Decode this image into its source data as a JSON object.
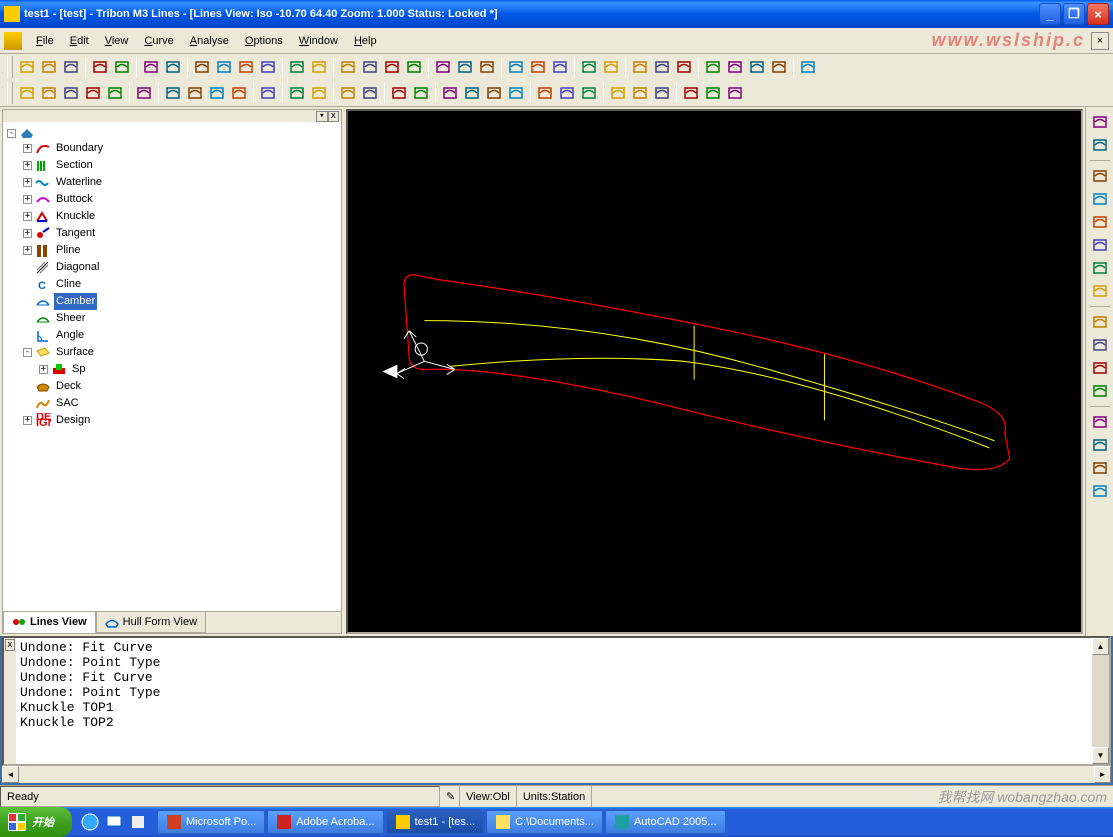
{
  "title": "test1 - [test] - Tribon M3 Lines - [Lines View: Iso -10.70 64.40   Zoom: 1.000   Status: Locked *]",
  "watermark_top": "www.wslship.c",
  "menus": [
    "File",
    "Edit",
    "View",
    "Curve",
    "Analyse",
    "Options",
    "Window",
    "Help"
  ],
  "tree": {
    "root_icon": "ship-icon",
    "items": [
      {
        "level": 1,
        "box": "+",
        "icon": "curve-red",
        "label": "Boundary"
      },
      {
        "level": 1,
        "box": "+",
        "icon": "curve-green",
        "label": "Section"
      },
      {
        "level": 1,
        "box": "+",
        "icon": "wave-blue",
        "label": "Waterline"
      },
      {
        "level": 1,
        "box": "+",
        "icon": "curve-pink",
        "label": "Buttock"
      },
      {
        "level": 1,
        "box": "+",
        "icon": "knuckle",
        "label": "Knuckle"
      },
      {
        "level": 1,
        "box": "+",
        "icon": "tangent",
        "label": "Tangent"
      },
      {
        "level": 1,
        "box": "+",
        "icon": "pline",
        "label": "Pline"
      },
      {
        "level": 1,
        "box": "",
        "icon": "diagonal",
        "label": "Diagonal"
      },
      {
        "level": 1,
        "box": "",
        "icon": "cline",
        "label": "Cline"
      },
      {
        "level": 1,
        "box": "",
        "icon": "camber",
        "label": "Camber",
        "selected": true
      },
      {
        "level": 1,
        "box": "",
        "icon": "sheer",
        "label": "Sheer"
      },
      {
        "level": 1,
        "box": "",
        "icon": "angle",
        "label": "Angle"
      },
      {
        "level": 1,
        "box": "-",
        "icon": "surface",
        "label": "Surface"
      },
      {
        "level": 2,
        "box": "+",
        "icon": "sp",
        "label": "Sp"
      },
      {
        "level": 1,
        "box": "",
        "icon": "deck",
        "label": "Deck"
      },
      {
        "level": 1,
        "box": "",
        "icon": "sac",
        "label": "SAC"
      },
      {
        "level": 1,
        "box": "+",
        "icon": "design",
        "label": "Design"
      }
    ]
  },
  "tree_tabs": {
    "active": "Lines View",
    "other": "Hull Form View"
  },
  "console_lines": [
    "Undone: Fit Curve",
    "Undone: Point Type",
    "Undone: Fit Curve",
    "Undone: Point Type",
    "Knuckle TOP1",
    "Knuckle TOP2"
  ],
  "status": {
    "ready": "Ready",
    "view": "View:Obl",
    "units": "Units:Station"
  },
  "watermark_bottom": "我帮找网 wobangzhao.com",
  "taskbar": {
    "start": "开始",
    "items": [
      {
        "icon": "#d04020",
        "label": "Microsoft Po..."
      },
      {
        "icon": "#d02020",
        "label": "Adobe Acroba..."
      },
      {
        "icon": "#ffcc00",
        "label": "test1 - [tes...",
        "active": true
      },
      {
        "icon": "#ffe060",
        "label": "C:\\Documents..."
      },
      {
        "icon": "#20a0a0",
        "label": "AutoCAD 2005..."
      }
    ]
  },
  "toolbars": {
    "row1_groups": [
      3,
      2,
      2,
      4,
      2,
      4,
      3,
      3,
      2,
      3,
      4,
      1
    ],
    "row2_groups": [
      5,
      1,
      4,
      1,
      2,
      2,
      2,
      4,
      3,
      3,
      3
    ]
  },
  "right_tool_count": 16
}
